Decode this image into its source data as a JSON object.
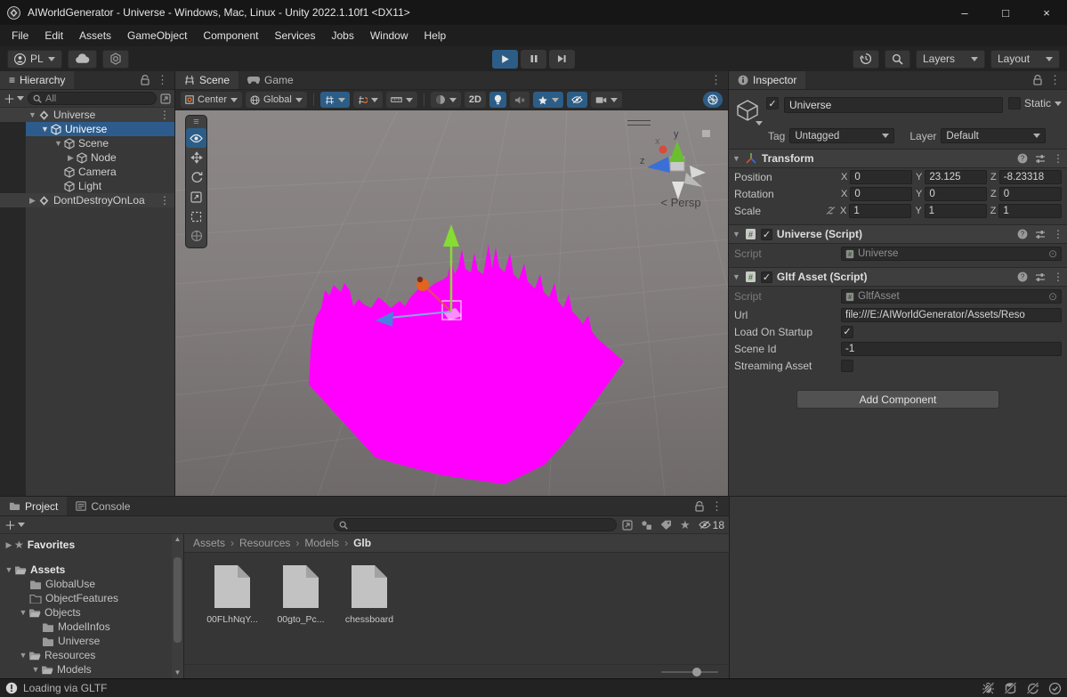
{
  "colors": {
    "accent_blue": "#2c5d87",
    "selection_blue": "#2d5c8c",
    "terrain_magenta": "#ff00ff"
  },
  "titlebar": {
    "title": "AIWorldGenerator - Universe - Windows, Mac, Linux - Unity 2022.1.10f1 <DX11>"
  },
  "menubar": {
    "items": [
      "File",
      "Edit",
      "Assets",
      "GameObject",
      "Component",
      "Services",
      "Jobs",
      "Window",
      "Help"
    ]
  },
  "toolbar": {
    "account": "PL",
    "layers": "Layers",
    "layout": "Layout"
  },
  "hierarchy": {
    "tab": "Hierarchy",
    "search_placeholder": "All",
    "items": [
      {
        "label": "Universe"
      },
      {
        "label": "Universe"
      },
      {
        "label": "Scene"
      },
      {
        "label": "Node"
      },
      {
        "label": "Camera"
      },
      {
        "label": "Light"
      },
      {
        "label": "DontDestroyOnLoa"
      }
    ]
  },
  "scene": {
    "tabs": [
      {
        "label": "Scene"
      },
      {
        "label": "Game"
      }
    ],
    "toolbar": {
      "center": "Center",
      "global": "Global",
      "mode_2d": "2D"
    },
    "persp_chevron": "<",
    "persp_label": "Persp",
    "axis": {
      "x": "x",
      "y": "y",
      "z": "z"
    }
  },
  "inspector": {
    "tab": "Inspector",
    "name": "Universe",
    "static_label": "Static",
    "tag_label": "Tag",
    "tag_value": "Untagged",
    "layer_label": "Layer",
    "layer_value": "Default",
    "transform": {
      "title": "Transform",
      "axis_labels": [
        "X",
        "Y",
        "Z"
      ],
      "rows": [
        {
          "label": "Position",
          "x": "0",
          "y": "23.125",
          "z": "-8.23318"
        },
        {
          "label": "Rotation",
          "x": "0",
          "y": "0",
          "z": "0"
        },
        {
          "label": "Scale",
          "x": "1",
          "y": "1",
          "z": "1"
        }
      ]
    },
    "universe_script": {
      "title": "Universe (Script)",
      "script_label": "Script",
      "script_value": "Universe"
    },
    "gltf": {
      "title": "Gltf Asset (Script)",
      "script_label": "Script",
      "script_value": "GltfAsset",
      "url_label": "Url",
      "url_value": "file:///E:/AIWorldGenerator/Assets/Reso",
      "load_label": "Load On Startup",
      "scene_id_label": "Scene Id",
      "scene_id_value": "-1",
      "streaming_label": "Streaming Asset"
    },
    "add_component": "Add Component"
  },
  "project": {
    "tabs": [
      {
        "label": "Project"
      },
      {
        "label": "Console"
      }
    ],
    "hidden_count": "18",
    "favorites_label": "Favorites",
    "tree": [
      {
        "label": "Assets"
      },
      {
        "label": "GlobalUse"
      },
      {
        "label": "ObjectFeatures"
      },
      {
        "label": "Objects"
      },
      {
        "label": "ModelInfos"
      },
      {
        "label": "Universe"
      },
      {
        "label": "Resources"
      },
      {
        "label": "Models"
      }
    ],
    "breadcrumb": [
      "Assets",
      "Resources",
      "Models",
      "Glb"
    ],
    "files": [
      {
        "name": "00FLhNqY..."
      },
      {
        "name": "00gto_Pc..."
      },
      {
        "name": "chessboard"
      }
    ]
  },
  "statusbar": {
    "message": "Loading via GLTF"
  }
}
